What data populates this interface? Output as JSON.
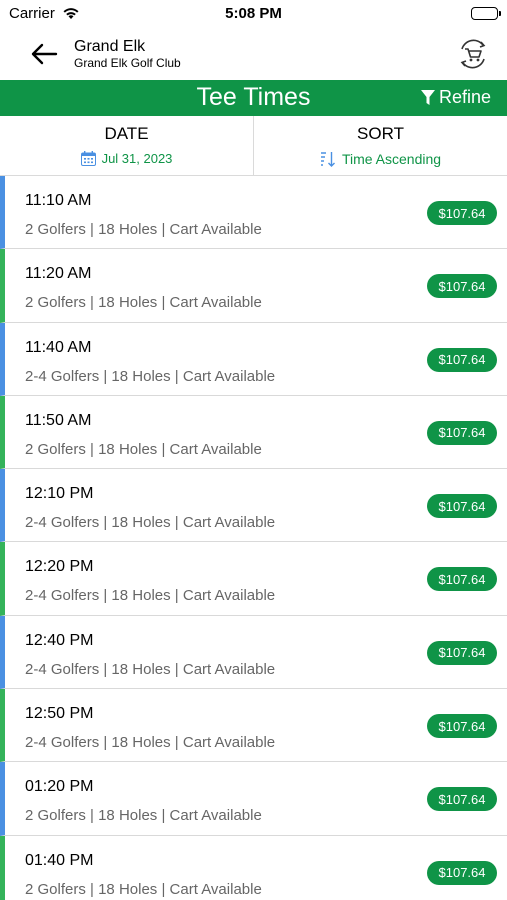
{
  "status_bar": {
    "carrier": "Carrier",
    "time": "5:08 PM"
  },
  "header": {
    "title": "Grand Elk",
    "subtitle": "Grand Elk Golf Club",
    "back_icon": "arrow-left-icon",
    "cart_icon": "cart-refresh-icon"
  },
  "toolbar": {
    "title": "Tee Times",
    "refine_label": "Refine",
    "accent_color": "#0f9447"
  },
  "filters": {
    "date_label": "DATE",
    "date_value": "Jul 31, 2023",
    "sort_label": "SORT",
    "sort_value": "Time Ascending"
  },
  "tee_times": [
    {
      "time": "11:10 AM",
      "details": "2 Golfers | 18 Holes  | Cart Available",
      "price": "$107.64",
      "accent": "blue"
    },
    {
      "time": "11:20 AM",
      "details": "2 Golfers | 18 Holes  | Cart Available",
      "price": "$107.64",
      "accent": "green"
    },
    {
      "time": "11:40 AM",
      "details": "2-4 Golfers | 18 Holes  | Cart Available",
      "price": "$107.64",
      "accent": "blue"
    },
    {
      "time": "11:50 AM",
      "details": "2 Golfers | 18 Holes  | Cart Available",
      "price": "$107.64",
      "accent": "green"
    },
    {
      "time": "12:10 PM",
      "details": "2-4 Golfers | 18 Holes  | Cart Available",
      "price": "$107.64",
      "accent": "blue"
    },
    {
      "time": "12:20 PM",
      "details": "2-4 Golfers | 18 Holes  | Cart Available",
      "price": "$107.64",
      "accent": "green"
    },
    {
      "time": "12:40 PM",
      "details": "2-4 Golfers | 18 Holes  | Cart Available",
      "price": "$107.64",
      "accent": "blue"
    },
    {
      "time": "12:50 PM",
      "details": "2-4 Golfers | 18 Holes  | Cart Available",
      "price": "$107.64",
      "accent": "green"
    },
    {
      "time": "01:20 PM",
      "details": "2 Golfers | 18 Holes  | Cart Available",
      "price": "$107.64",
      "accent": "blue"
    },
    {
      "time": "01:40 PM",
      "details": "2 Golfers | 18 Holes  | Cart Available",
      "price": "$107.64",
      "accent": "green"
    }
  ]
}
